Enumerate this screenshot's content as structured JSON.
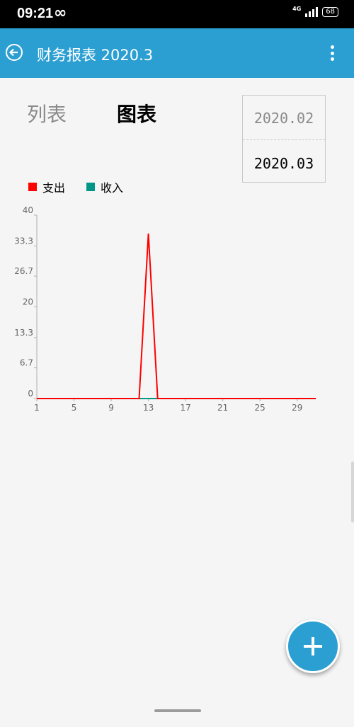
{
  "status": {
    "time": "09:21",
    "network": "4G",
    "battery": "68"
  },
  "appbar": {
    "title": "财务报表 2020.3"
  },
  "tabs": {
    "list": "列表",
    "chart": "图表"
  },
  "picker": {
    "previous": "2020.02",
    "current": "2020.03"
  },
  "colors": {
    "primary": "#2b9fd2",
    "expense": "#ff0000",
    "income": "#009688"
  },
  "chart_data": {
    "type": "line",
    "title": "",
    "xlabel": "",
    "ylabel": "",
    "x": [
      1,
      2,
      3,
      4,
      5,
      6,
      7,
      8,
      9,
      10,
      11,
      12,
      13,
      14,
      15,
      16,
      17,
      18,
      19,
      20,
      21,
      22,
      23,
      24,
      25,
      26,
      27,
      28,
      29,
      30,
      31
    ],
    "series": [
      {
        "name": "支出",
        "color": "#ff0000",
        "values": [
          0,
          0,
          0,
          0,
          0,
          0,
          0,
          0,
          0,
          0,
          0,
          0,
          36,
          0,
          0,
          0,
          0,
          0,
          0,
          0,
          0,
          0,
          0,
          0,
          0,
          0,
          0,
          0,
          0,
          0,
          0
        ]
      },
      {
        "name": "收入",
        "color": "#009688",
        "values": [
          0,
          0,
          0,
          0,
          0,
          0,
          0,
          0,
          0,
          0,
          0,
          0,
          0,
          0,
          0,
          0,
          0,
          0,
          0,
          0,
          0,
          0,
          0,
          0,
          0,
          0,
          0,
          0,
          0,
          0,
          0
        ]
      }
    ],
    "xticks": [
      "1",
      "5",
      "9",
      "13",
      "17",
      "21",
      "25",
      "29"
    ],
    "yticks": [
      "0",
      "6.7",
      "13.3",
      "20",
      "26.7",
      "33.3",
      "40"
    ],
    "xlim": [
      1,
      31
    ],
    "ylim": [
      0,
      40
    ],
    "legend": "top-left",
    "grid": false
  }
}
